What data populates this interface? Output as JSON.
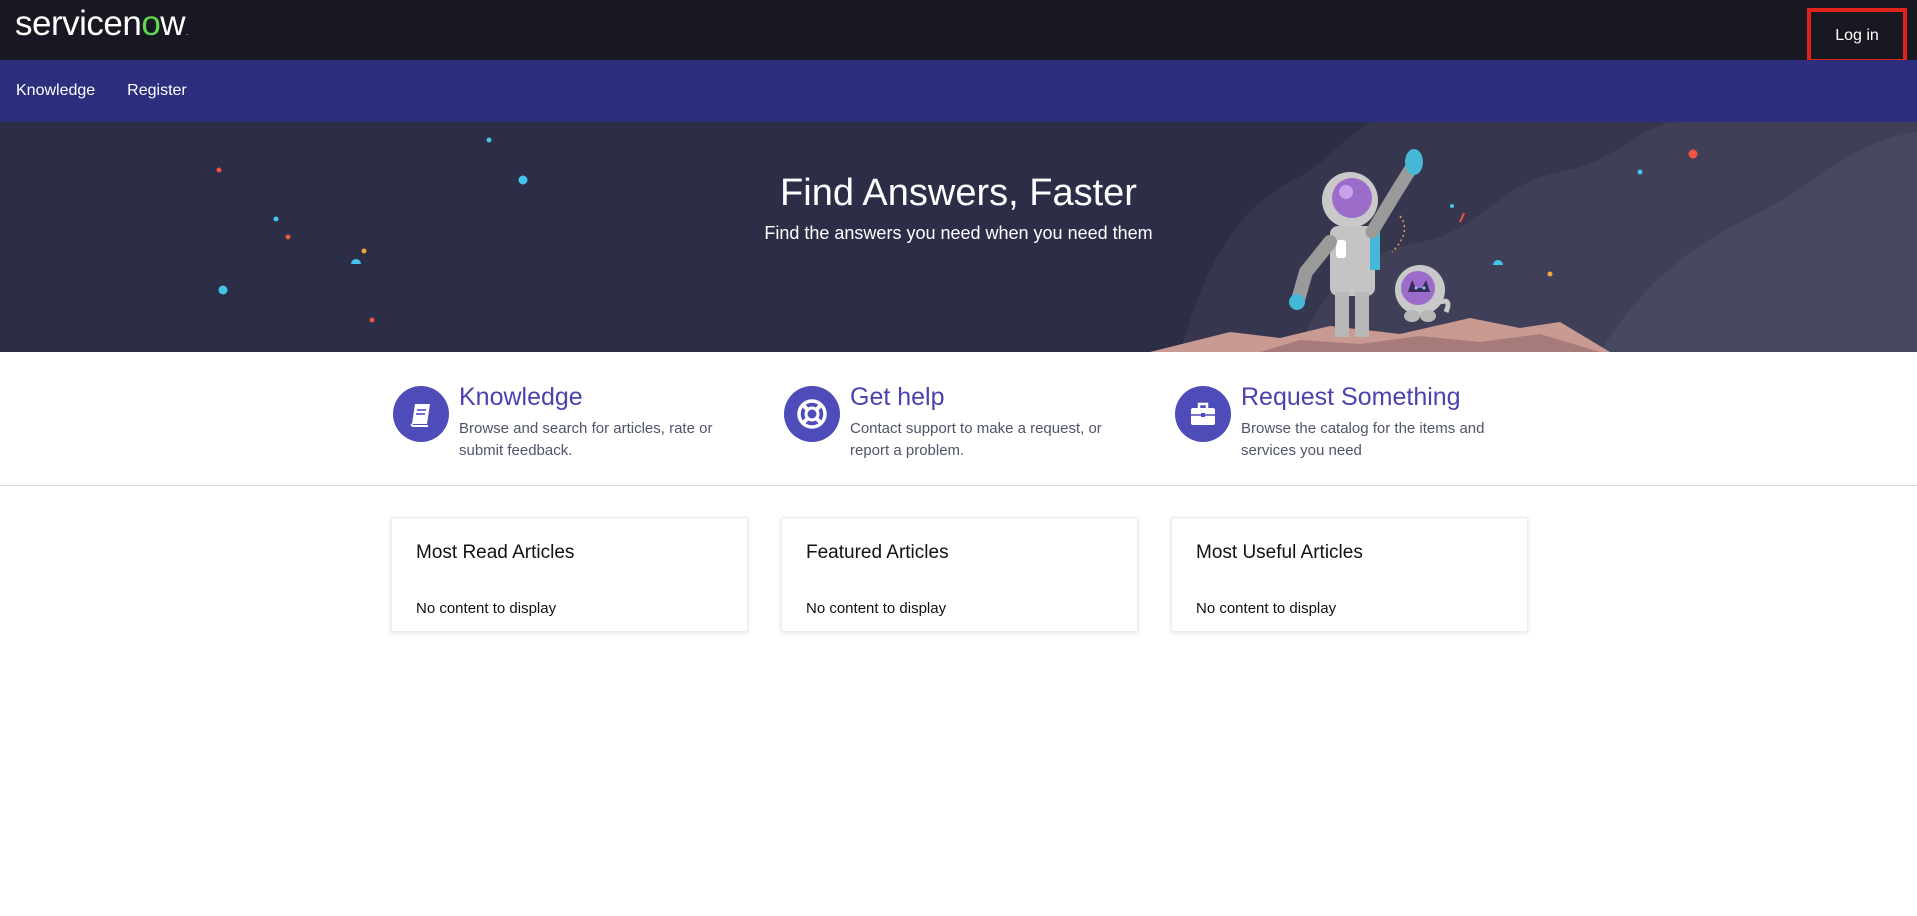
{
  "header": {
    "logo_text": "servicenow",
    "login_label": "Log in",
    "login_outline_color": "#e1231b"
  },
  "nav": {
    "items": [
      {
        "label": "Knowledge"
      },
      {
        "label": "Register"
      }
    ]
  },
  "hero": {
    "title": "Find Answers, Faster",
    "subtitle": "Find the answers you need when you need them",
    "illustration_icon": "astronaut-and-cat-illustration"
  },
  "features": [
    {
      "icon": "book-icon",
      "title": "Knowledge",
      "desc1": "Browse and search for articles, rate or",
      "desc2": "submit feedback."
    },
    {
      "icon": "lifebuoy-icon",
      "title": "Get help",
      "desc1": "Contact support to make a request, or",
      "desc2": "report a problem."
    },
    {
      "icon": "briefcase-icon",
      "title": "Request Something",
      "desc1": "Browse the catalog for the items and",
      "desc2": "services you need"
    }
  ],
  "cards": [
    {
      "title": "Most Read Articles",
      "body": "No content to display"
    },
    {
      "title": "Featured Articles",
      "body": "No content to display"
    },
    {
      "title": "Most Useful Articles",
      "body": "No content to display"
    }
  ],
  "colors": {
    "topbar": "#171821",
    "navbar": "#2d2e7e",
    "hero": "#2c2d47",
    "accent": "#4e4cb8"
  }
}
